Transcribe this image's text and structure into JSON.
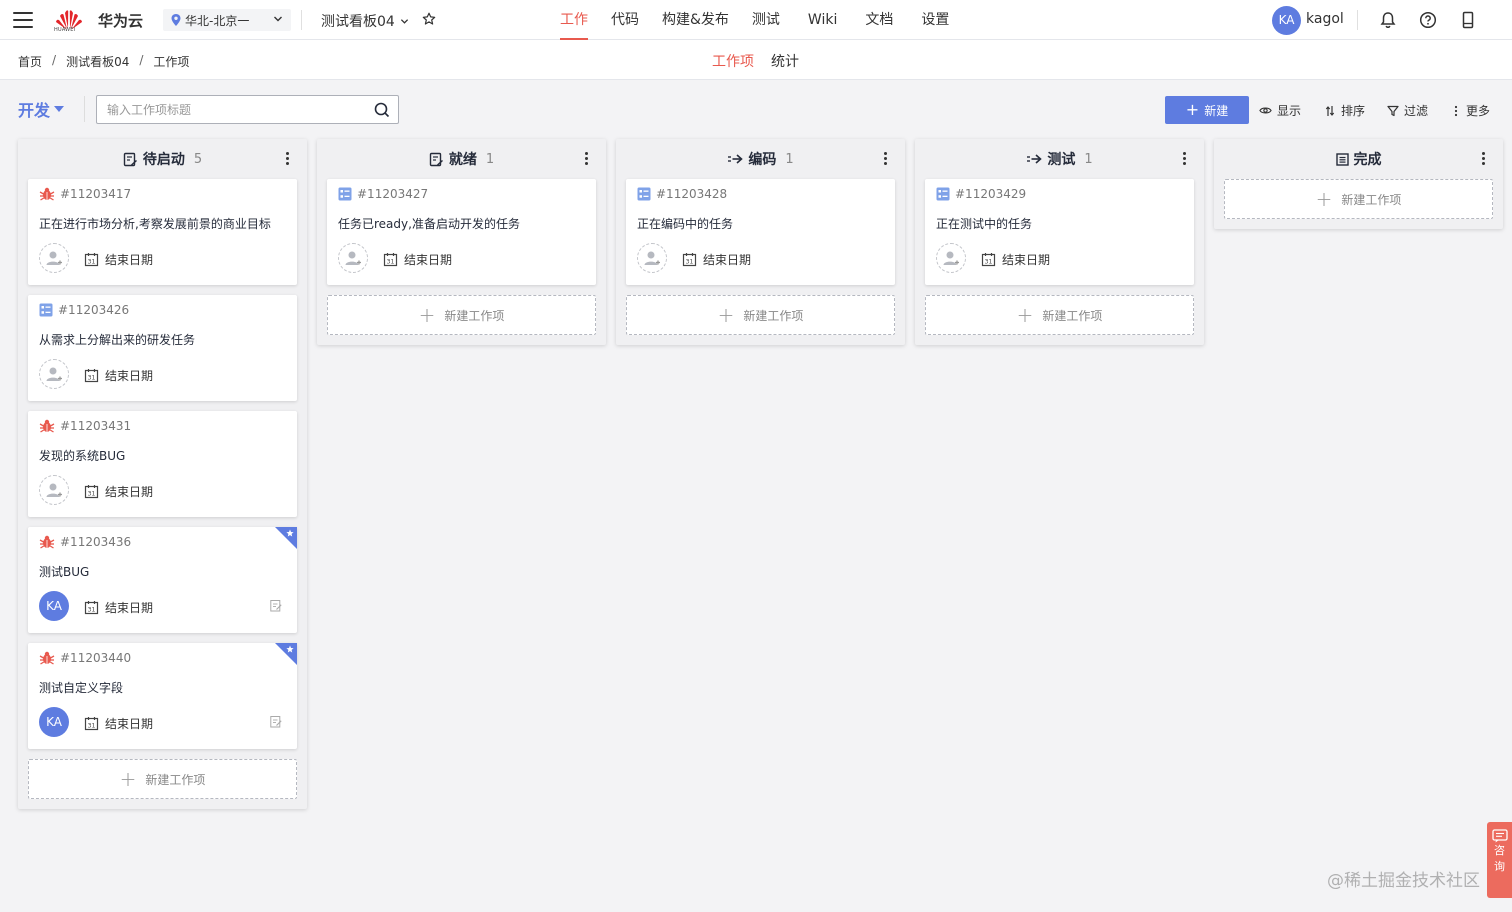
{
  "topnav": {
    "brand": "华为云",
    "logo_sub": "HUAWEI",
    "region": "华北-北京一",
    "project": "测试看板04",
    "nav": [
      "工作",
      "代码",
      "构建&发布",
      "测试",
      "Wiki",
      "文档",
      "设置"
    ],
    "active_nav": "工作",
    "user_initials": "KA",
    "username": "kagol"
  },
  "subbar": {
    "breadcrumb": [
      "首页",
      "测试看板04",
      "工作项"
    ],
    "separator": "/",
    "tabs": [
      "工作项",
      "统计"
    ]
  },
  "toolbar": {
    "mode": "开发",
    "search_placeholder": "输入工作项标题",
    "new_label": "新建",
    "show_label": "显示",
    "sort_label": "排序",
    "filter_label": "过滤",
    "more_label": "更多"
  },
  "new_item_label": "新建工作项",
  "end_date_label": "结束日期",
  "columns": [
    {
      "name": "待启动",
      "count": "5",
      "icon": "todo-icon",
      "cards": [
        {
          "id": "#11203417",
          "type": "bug",
          "title": "正在进行市场分析,考察发展前景的商业目标",
          "assignee": ""
        },
        {
          "id": "#11203426",
          "type": "task",
          "title": "从需求上分解出来的研发任务",
          "assignee": ""
        },
        {
          "id": "#11203431",
          "type": "bug",
          "title": "发现的系统BUG",
          "assignee": ""
        },
        {
          "id": "#11203436",
          "type": "bug",
          "title": "测试BUG",
          "assignee": "KA",
          "flagged": true
        },
        {
          "id": "#11203440",
          "type": "bug",
          "title": "测试自定义字段",
          "assignee": "KA",
          "flagged": true
        }
      ]
    },
    {
      "name": "就绪",
      "count": "1",
      "icon": "ready-icon",
      "cards": [
        {
          "id": "#11203427",
          "type": "task",
          "title": "任务已ready,准备启动开发的任务",
          "assignee": ""
        }
      ]
    },
    {
      "name": "编码",
      "count": "1",
      "icon": "arrow-right-icon",
      "cards": [
        {
          "id": "#11203428",
          "type": "task",
          "title": "正在编码中的任务",
          "assignee": ""
        }
      ]
    },
    {
      "name": "测试",
      "count": "1",
      "icon": "arrow-right-icon",
      "cards": [
        {
          "id": "#11203429",
          "type": "task",
          "title": "正在测试中的任务",
          "assignee": ""
        }
      ]
    },
    {
      "name": "完成",
      "count": "",
      "icon": "done-icon",
      "cards": []
    }
  ],
  "watermark": "@稀土掘金技术社区",
  "consult": [
    "咨",
    "询"
  ],
  "colors": {
    "accent": "#5e7ce0",
    "active": "#e8594e",
    "bug": "#e8594e",
    "task": "#7fa2e8"
  }
}
